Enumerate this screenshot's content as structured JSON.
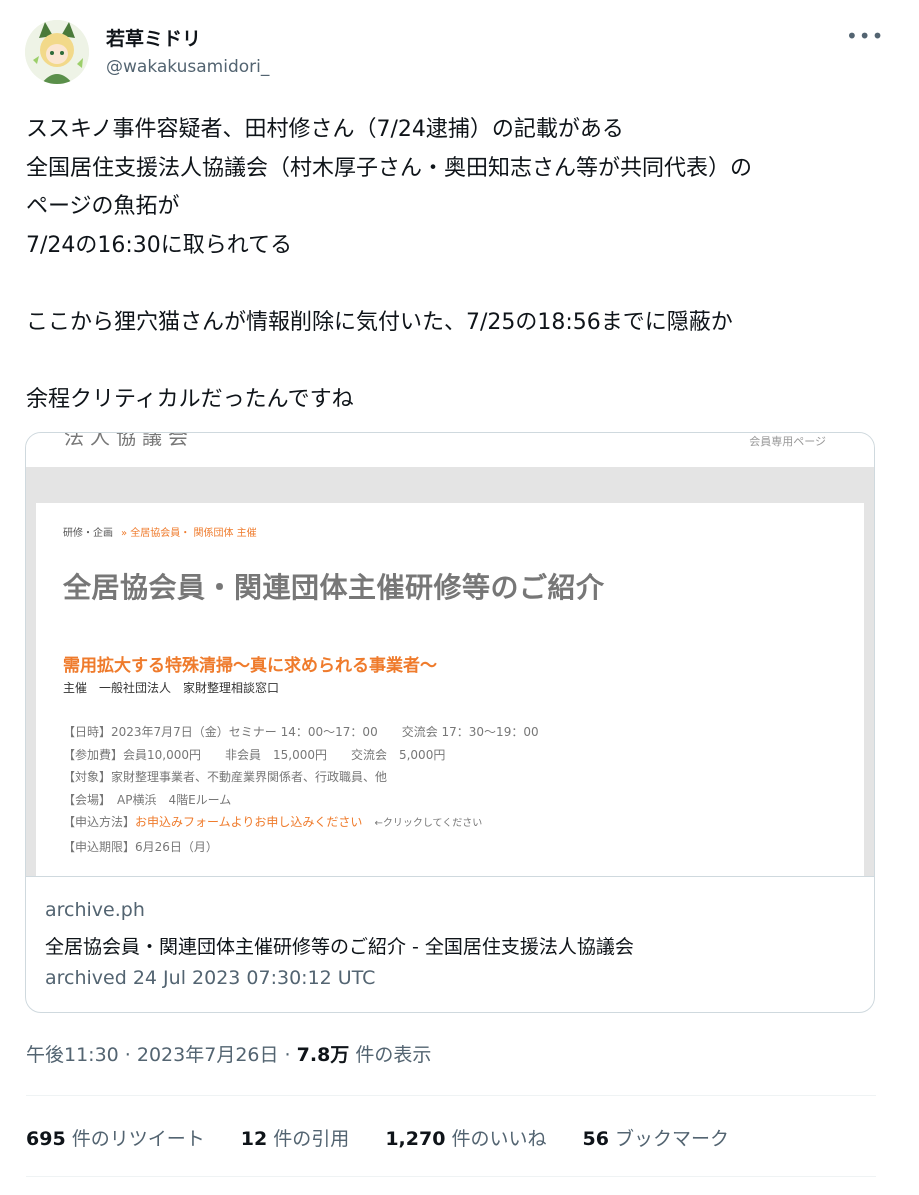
{
  "author": {
    "name": "若草ミドリ",
    "handle": "@wakakusamidori_"
  },
  "tweet": {
    "text": "ススキノ事件容疑者、田村修さん（7/24逮捕）の記載がある\n全国居住支援法人協議会（村木厚子さん・奥田知志さん等が共同代表）の\nページの魚拓が\n7/24の16:30に取られてる\n\nここから狸穴猫さんが情報削除に気付いた、7/25の18:56までに隠蔽か\n\n余程クリティカルだったんですね"
  },
  "archive_page": {
    "header_cut_text": "法人協議会",
    "member_link": "会員専用ページ",
    "breadcrumb_root": "研修・企画",
    "breadcrumb_current": "» 全居協会員・ 関係団体 主催",
    "page_title": "全居協会員・関連団体主催研修等のご紹介",
    "event_title": "需用拡大する特殊清掃〜真に求められる事業者〜",
    "host": "主催　一般社団法人　家財整理相談窓口",
    "details": {
      "date": "【日時】2023年7月7日（金）セミナー 14：00〜17：00　　交流会 17：30〜19：00",
      "fee": "【参加費】会員10,000円　　非会員　15,000円　　交流会　5,000円",
      "target": "【対象】家財整理事業者、不動産業界関係者、行政職員、他",
      "venue": "【会場】　AP横浜　4階Eルーム",
      "apply_label": "【申込方法】",
      "apply_link": "お申込みフォームよりお申し込みください",
      "apply_note": "←クリックしてください",
      "deadline": "【申込期限】6月26日（月）"
    }
  },
  "card": {
    "domain": "archive.ph",
    "title": "全居協会員・関連団体主催研修等のご紹介 - 全国居住支援法人協議会",
    "description": "archived 24 Jul 2023 07:30:12 UTC"
  },
  "meta": {
    "time": "午後11:30 · 2023年7月26日 · ",
    "views": "7.8万",
    "views_label": " 件の表示"
  },
  "stats": {
    "retweets": "695",
    "retweets_label": " 件のリツイート",
    "quotes": "12",
    "quotes_label": " 件の引用",
    "likes": "1,270",
    "likes_label": " 件のいいね",
    "bookmarks": "56",
    "bookmarks_label": " ブックマーク"
  },
  "icons": {
    "more": "more-icon",
    "avatar": "avatar"
  },
  "colors": {
    "accent_orange": "#ef7b2c",
    "secondary_text": "#536471",
    "border": "#cfd9de"
  }
}
